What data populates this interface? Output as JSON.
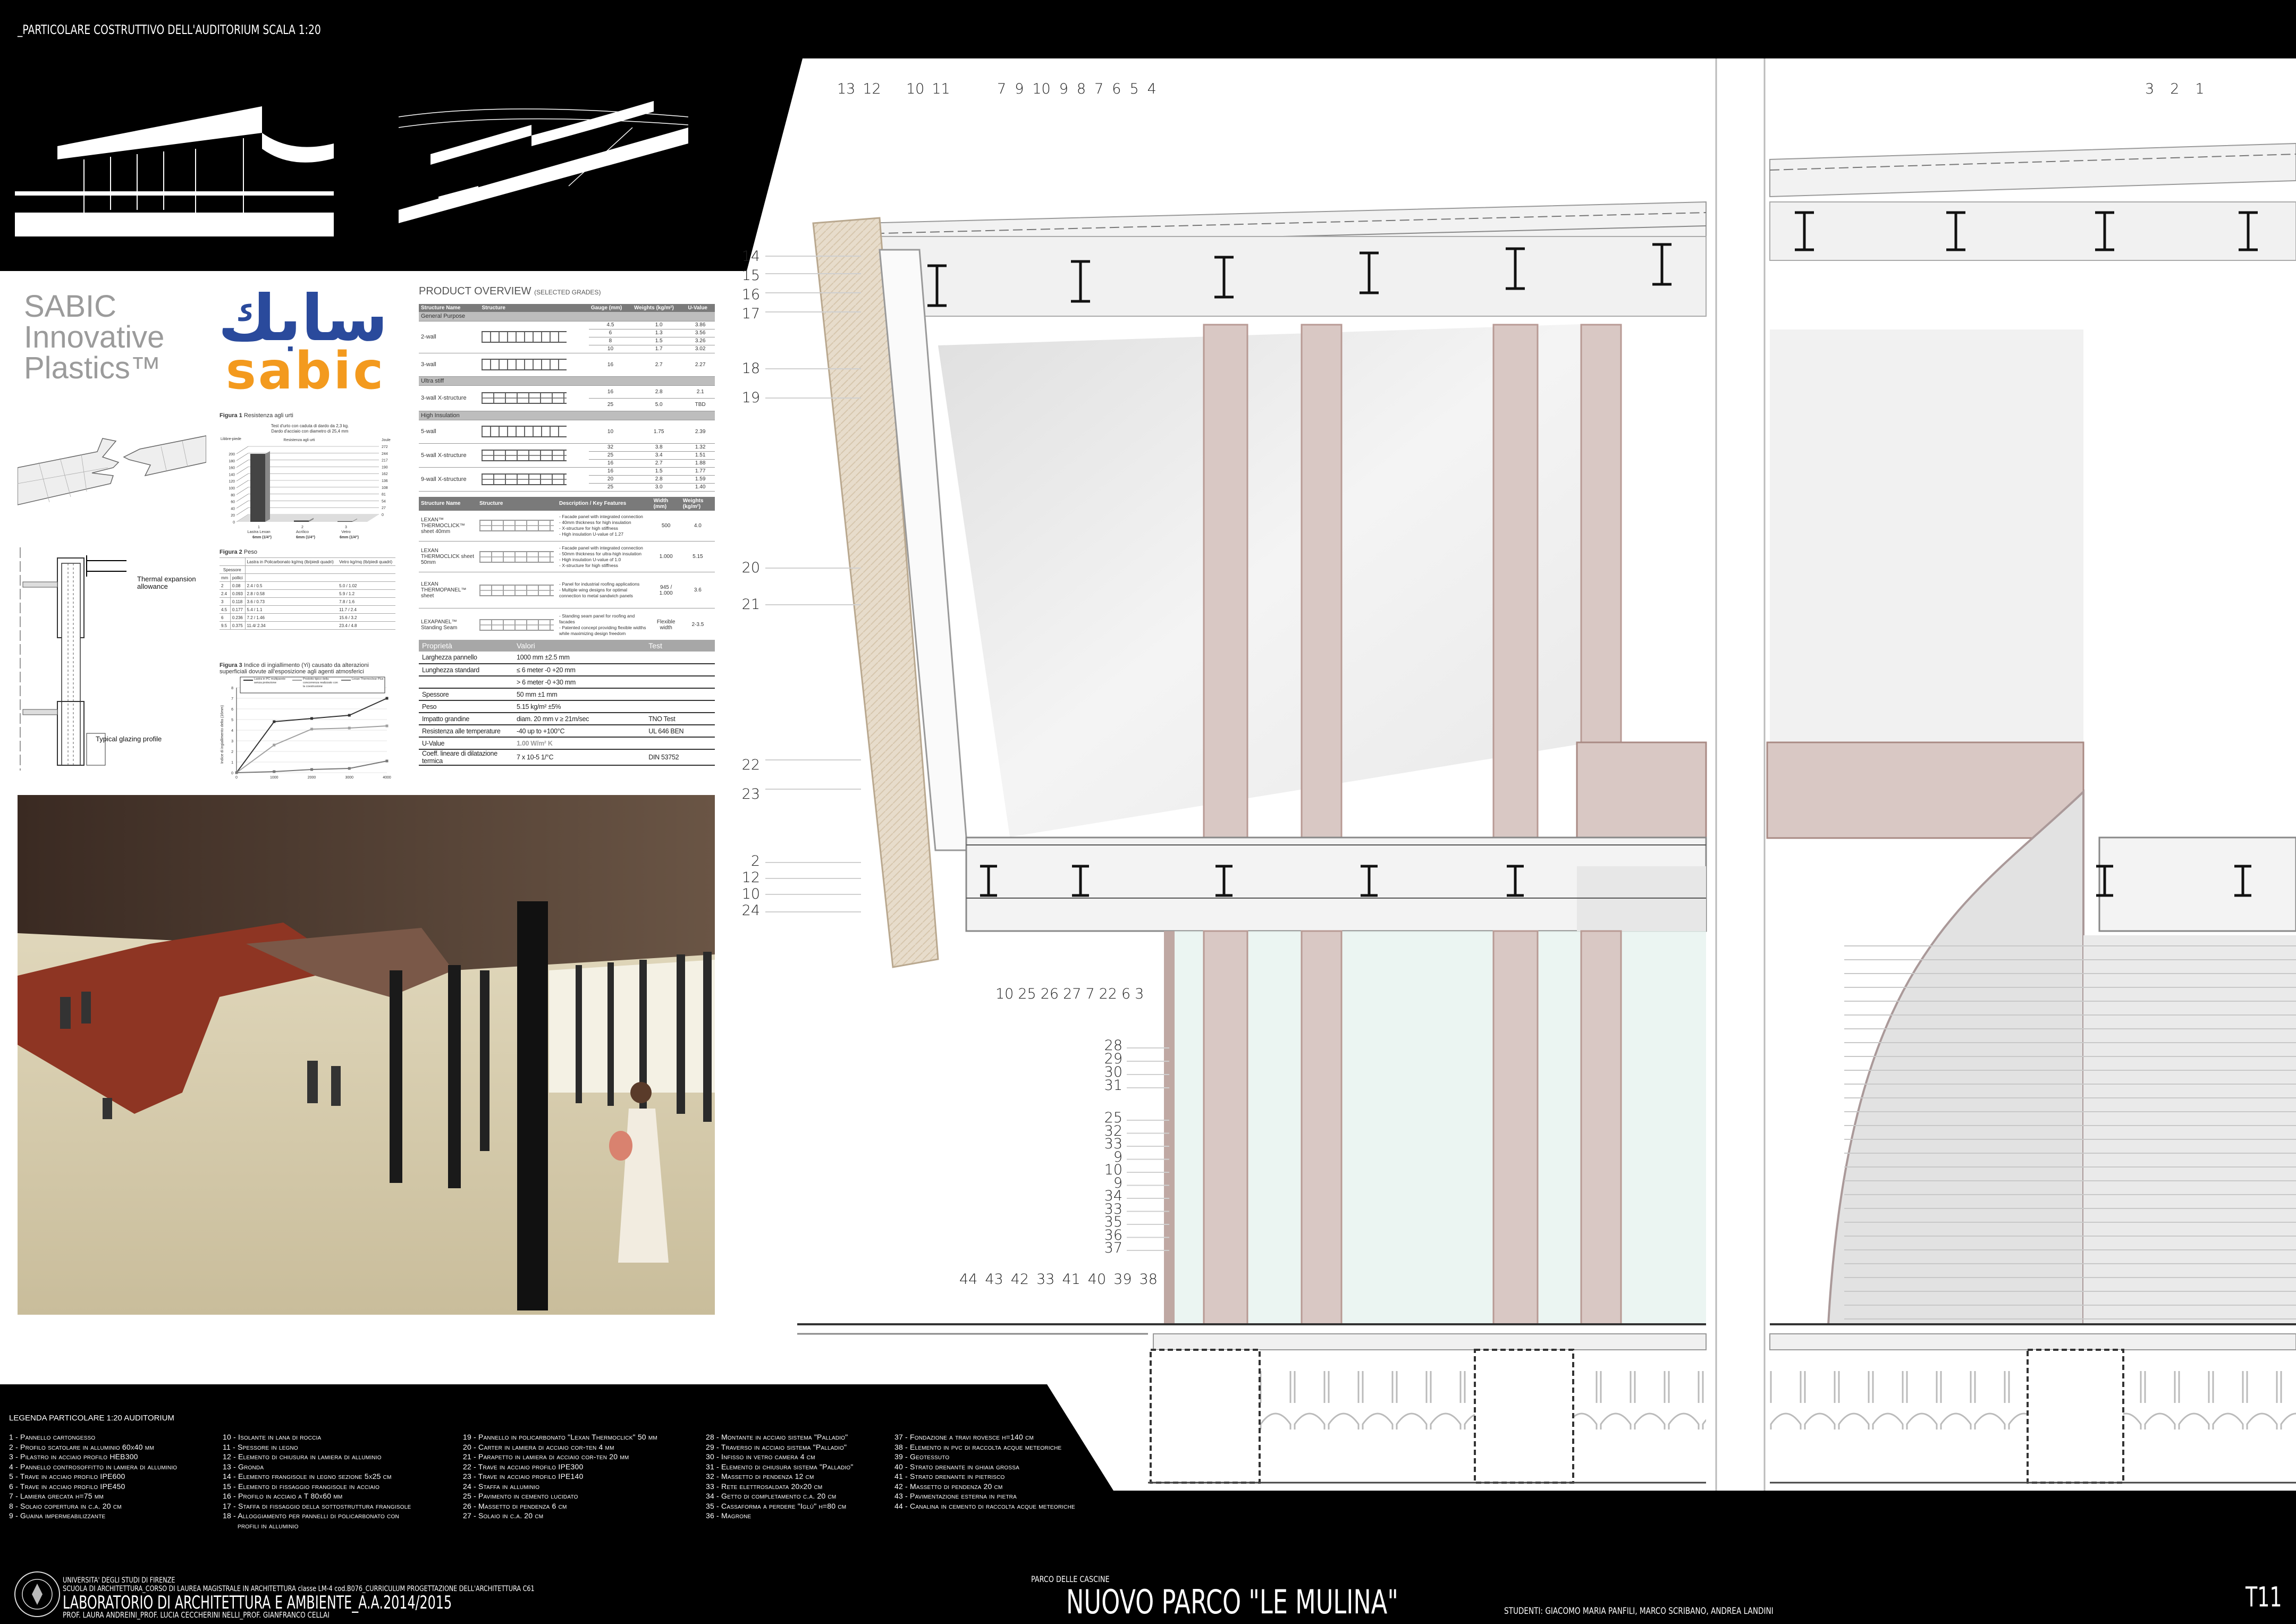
{
  "header": {
    "title": "_PARTICOLARE COSTRUTTIVO DELL'AUDITORIUM   SCALA 1:20"
  },
  "sabic": {
    "wordmark": [
      "SABIC",
      "Innovative",
      "Plastics™"
    ],
    "logo_arabic": "سابك",
    "logo_latin": "sabic",
    "colors": {
      "blue": "#2a4a9c",
      "orange": "#f39a1e",
      "grey": "#9b9b9b"
    }
  },
  "product_overview": {
    "title": "PRODUCT OVERVIEW",
    "subtitle": "(SELECTED GRADES)",
    "table1": {
      "headers": [
        "Structure Name",
        "Structure",
        "Gauge (mm)",
        "Weights (kg/m²)",
        "U-Value"
      ],
      "groups": [
        {
          "name": "General Purpose",
          "rows": [
            {
              "name": "2-wall",
              "struct": "plain",
              "values": [
                [
                  "4.5",
                  "1.0",
                  "3.86"
                ],
                [
                  "6",
                  "1.3",
                  "3.56"
                ],
                [
                  "8",
                  "1.5",
                  "3.26"
                ],
                [
                  "10",
                  "1.7",
                  "3.02"
                ]
              ]
            },
            {
              "name": "3-wall",
              "struct": "plain",
              "values": [
                [
                  "16",
                  "2.7",
                  "2.27"
                ]
              ]
            }
          ]
        },
        {
          "name": "Ultra stiff",
          "rows": [
            {
              "name": "3-wall X-structure",
              "struct": "x",
              "values": [
                [
                  "16",
                  "2.8",
                  "2.1"
                ],
                [
                  "25",
                  "5.0",
                  "TBD"
                ]
              ]
            }
          ]
        },
        {
          "name": "High Insulation",
          "rows": [
            {
              "name": "5-wall",
              "struct": "plain",
              "values": [
                [
                  "10",
                  "1.75",
                  "2.39"
                ]
              ]
            },
            {
              "name": "5-wall X-structure",
              "struct": "x",
              "values": [
                [
                  "32",
                  "3.8",
                  "1.32"
                ],
                [
                  "25",
                  "3.4",
                  "1.51"
                ],
                [
                  "16",
                  "2.7",
                  "1.88"
                ]
              ]
            },
            {
              "name": "9-wall X-structure",
              "struct": "x",
              "values": [
                [
                  "16",
                  "1.5",
                  "1.77"
                ],
                [
                  "20",
                  "2.8",
                  "1.59"
                ],
                [
                  "25",
                  "3.0",
                  "1.40"
                ]
              ]
            }
          ]
        }
      ]
    },
    "table2": {
      "headers": [
        "Structure Name",
        "Structure",
        "Description / Key Features",
        "Width (mm)",
        "Weights (kg/m²)"
      ],
      "rows": [
        {
          "name": "LEXAN™ THERMOCLICK™ sheet 40mm",
          "features": [
            "- Facade panel with integrated connection",
            "- 40mm thickness for high insulation",
            "- X-structure for high stiffness",
            "- High insulation U-value of 1.27"
          ],
          "width": "500",
          "weight": "4.0"
        },
        {
          "name": "LEXAN THERMOCLICK sheet 50mm",
          "features": [
            "- Facade panel with integrated connection",
            "- 50mm thickness for ultra-high insulation",
            "- High insulation U-value of 1.0",
            "- X-structure for high stiffness"
          ],
          "width": "1.000",
          "weight": "5.15"
        },
        {
          "name": "LEXAN THERMOPANEL™ sheet",
          "features": [
            "- Panel for industrial roofing applications",
            "- Multiple wing designs for optimal connection to metal sandwich panels"
          ],
          "width": "945 / 1.000",
          "weight": "3.6"
        },
        {
          "name": "LEXAPANEL™ Standing Seam",
          "features": [
            "- Standing seam panel for roofing and facades",
            "- Patented concept providing flexible widths while maximizing design freedom"
          ],
          "width": "Flexible width",
          "weight": "2-3.5"
        }
      ]
    },
    "properties": {
      "headers": [
        "Proprietà",
        "Valori",
        "Test"
      ],
      "rows": [
        [
          "Larghezza pannello",
          "1000 mm ±2.5 mm",
          ""
        ],
        [
          "Lunghezza standard",
          "≤ 6 meter -0 +20 mm",
          ""
        ],
        [
          "",
          "> 6 meter -0 +30 mm",
          ""
        ],
        [
          "Spessore",
          "50 mm ±1 mm",
          ""
        ],
        [
          "Peso",
          "5.15 kg/m² ±5%",
          ""
        ],
        [
          "Impatto grandine",
          "diam. 20 mm v ≥ 21m/sec",
          "TNO Test"
        ],
        [
          "Resistenza alle temperature",
          "-40 up to +100°C",
          "UL 646 BEN"
        ],
        [
          "U-Value",
          "1.00 W/m² K",
          ""
        ],
        [
          "Coeff. lineare di dilatazione termica",
          "7 x 10-5 1/°C",
          "DIN 53752"
        ]
      ]
    }
  },
  "glazing": {
    "thermal": "Thermal expansion allowance",
    "typical": "Typical glazing profile"
  },
  "fig2": {
    "title_bold": "Figura 2",
    "title": "Peso",
    "col_pc": "Lastra in Policarbonato kg/mq (lb/piedi quadri)",
    "col_glass": "Vetro kg/mq (lb/piedi quadri)",
    "spessore": "Spessore",
    "mm": "mm",
    "pollici": "pollici",
    "rows": [
      [
        "2",
        "0.08",
        "2.4 / 0.5",
        "5.0 / 1.02"
      ],
      [
        "2.4",
        "0.093",
        "2.8 / 0.58",
        "5.9 / 1.2"
      ],
      [
        "3",
        "0.118",
        "3.6 / 0.73",
        "7.8 / 1.6"
      ],
      [
        "4.5",
        "0.177",
        "5.4 / 1.1",
        "11.7 / 2.4"
      ],
      [
        "6",
        "0.236",
        "7.2 / 1.46",
        "15.6 / 3.2"
      ],
      [
        "9.5",
        "0.375",
        "11.4/ 2.34",
        "23.4 / 4.8"
      ]
    ]
  },
  "chart_data": [
    {
      "type": "bar",
      "title_bold": "Figura 1",
      "title": "Resistenza agli urti",
      "subtitle": [
        "Test d'urto con caduta di dardo da 2,3 kg.",
        "Dardo d'acciaio con diametro di 25,4 mm"
      ],
      "inner_title": "Resistenza agli urti",
      "ylabel": "Libbre-piede",
      "ylabel_right": "Joule",
      "categories": [
        {
          "n": "1",
          "name": "Lastra Lexan",
          "size": "6mm (1/4\")"
        },
        {
          "n": "2",
          "name": "Acrilico",
          "size": "6mm (1/4\")"
        },
        {
          "n": "3",
          "name": "Vetro",
          "size": "6mm (1/4\")"
        }
      ],
      "values": [
        200,
        4,
        2
      ],
      "ylim": [
        0,
        200
      ],
      "yticks": [
        0,
        20,
        40,
        60,
        80,
        100,
        120,
        140,
        160,
        180,
        200
      ],
      "yticks_right": [
        "0",
        "27",
        "54",
        "81",
        "108",
        "136",
        "162",
        "190",
        "217",
        "244",
        "272"
      ],
      "bar_color": "#444444",
      "grid": true
    },
    {
      "type": "line",
      "title_bold": "Figura 3",
      "title": "Indice di ingiallimento (Yi) causato da alterazioni superficiali dovute all'esposizione agli agenti atmosferici",
      "ylabel": "Indice di ingiallimento delta (16mm)",
      "x": [
        0,
        1000,
        2000,
        3000,
        4000
      ],
      "ylim": [
        0,
        8
      ],
      "yticks": [
        0,
        1,
        2,
        3,
        4,
        5,
        6,
        7,
        8
      ],
      "legend": "top",
      "series": [
        {
          "name": "Lastra in PC multiparete senza protezione",
          "values": [
            0,
            4.8,
            5.1,
            5.4,
            7.0
          ],
          "color": "#333333",
          "marker": "diamond"
        },
        {
          "name": "Prodotto tipico della concorrenza realizzato con la coestrusione",
          "values": [
            0,
            2.6,
            4.1,
            4.2,
            4.4
          ],
          "color": "#a0a0a0",
          "marker": "triangle"
        },
        {
          "name": "Lexan Thermoclear Plus",
          "values": [
            0,
            0.1,
            0.3,
            0.4,
            1.1
          ],
          "color": "#777777",
          "marker": "square"
        }
      ],
      "grid": true
    }
  ],
  "drawing": {
    "labels": {
      "top_a": [
        "13",
        "12"
      ],
      "top_b": [
        "10",
        "11"
      ],
      "top_c": [
        "7",
        "9",
        "10",
        "9",
        "8",
        "7",
        "6",
        "5",
        "4"
      ],
      "top_right": [
        "3",
        "2",
        "1"
      ],
      "left_a": [
        "14",
        "15",
        "16",
        "17"
      ],
      "left_b": [
        "18"
      ],
      "left_c": [
        "19"
      ],
      "left_d": [
        "20"
      ],
      "left_e": [
        "21"
      ],
      "left_f": [
        "22",
        "23"
      ],
      "left_g": [
        "2",
        "12",
        "10",
        "24"
      ],
      "mid_row": [
        "10",
        "25",
        "26",
        "27",
        "7",
        "22",
        "6",
        "3"
      ],
      "col_a": [
        "28",
        "29",
        "30",
        "31"
      ],
      "col_b": [
        "25",
        "32",
        "33",
        "9",
        "10",
        "9",
        "34",
        "33",
        "35",
        "36",
        "37"
      ],
      "bottom_row": [
        "44",
        "43",
        "42",
        "33",
        "41",
        "40",
        "39",
        "38"
      ]
    },
    "colors": {
      "column": "#d9c8c4",
      "glass": "#e6f2ef",
      "wood": "#e7dccb"
    }
  },
  "legend": {
    "title": "LEGENDA PARTICOLARE 1:20 AUDITORIUM",
    "columns": [
      [
        "1 - Pannello cartongesso",
        "2 - Profilo scatolare in alluminio 60x40 mm",
        "3 - Pilastro in acciaio profilo HEB300",
        "4 - Pannello controsoffitto in lamiera di alluminio",
        "5 - Trave in acciaio profilo IPE600",
        "6 - Trave in acciaio profilo IPE450",
        "7 - Lamiera grecata h=75 mm",
        "8 - Solaio copertura in c.a. 20 cm",
        "9 - Guaina impermeabilizzante"
      ],
      [
        "10 - Isolante in lana di roccia",
        "11 - Spessore in legno",
        "12 - Elemento di chiusura in lamiera di alluminio",
        "13 - Gronda",
        "14 - Elemento frangisole in legno sezione 5x25 cm",
        "15 - Elemento di fissaggio frangisole in acciaio",
        "16 - Profilo in acciaio a T 80x60 mm",
        "17 - Staffa di fissaggio della sottostruttura frangisole",
        "18 - Alloggiamento per pannelli di policarbonato con",
        "profili in alluminio"
      ],
      [
        "19 - Pannello in policarbonato \"Lexan Thermoclick\" 50 mm",
        "20 - Carter in lamiera di acciaio cor-ten 4 mm",
        "21 - Parapetto in lamiera di acciaio cor-ten 20 mm",
        "22 - Trave in acciaio profilo IPE300",
        "23 - Trave in acciaio profilo IPE140",
        "24 - Staffa in alluminio",
        "25 - Pavimento in cemento lucidato",
        "26 - Massetto di pendenza 6 cm",
        "27 - Solaio in c.a. 20 cm"
      ],
      [
        "28 - Montante in acciaio sistema \"Palladio\"",
        "29 - Traverso in acciaio sistema \"Palladio\"",
        "30 - Infisso in vetro camera 4 cm",
        "31 - Elemento di chiusura sistema \"Palladio\"",
        "32 - Massetto di pendenza 12 cm",
        "33 - Rete elettrosaldata 20x20 cm",
        "34 - Getto di completamento c.a. 20 cm",
        "35 - Cassaforma a perdere \"Iglù\" h=80 cm",
        "36 - Magrone"
      ],
      [
        "37 - Fondazione a travi rovesce h=140 cm",
        "38 - Elemento in pvc di raccolta acque meteoriche",
        "39 - Geotessuto",
        "40 - Strato drenante in ghiaia grossa",
        "41 - Strato drenante in pietrisco",
        "42 - Massetto di pendenza 20 cm",
        "43 - Pavimentazione esterna in pietra",
        "44 - Canalina in cemento di raccolta acque meteoriche"
      ]
    ]
  },
  "footer": {
    "university": "UNIVERSITA' DEGLI STUDI DI FIRENZE",
    "school": "SCUOLA DI ARCHITETTURA_CORSO DI LAUREA MAGISTRALE IN ARCHITETTURA classe LM-4 cod.B076_CURRICULUM PROGETTAZIONE DELL'ARCHITETTURA C61",
    "lab": "LABORATORIO DI ARCHITETTURA E AMBIENTE_A.A.2014/2015",
    "profs": "PROF. LAURA ANDREINI_PROF. LUCIA CECCHERINI NELLI_PROF. GIANFRANCO CELLAI",
    "seal_text": "STUDIORUM FLORENTINA UNIVERSITAS",
    "place": "PARCO DELLE CASCINE",
    "project": "NUOVO PARCO \"LE MULINA\"",
    "students": "STUDENTI: GIACOMO MARIA PANFILI, MARCO SCRIBANO, ANDREA LANDINI",
    "sheet": "T11"
  }
}
